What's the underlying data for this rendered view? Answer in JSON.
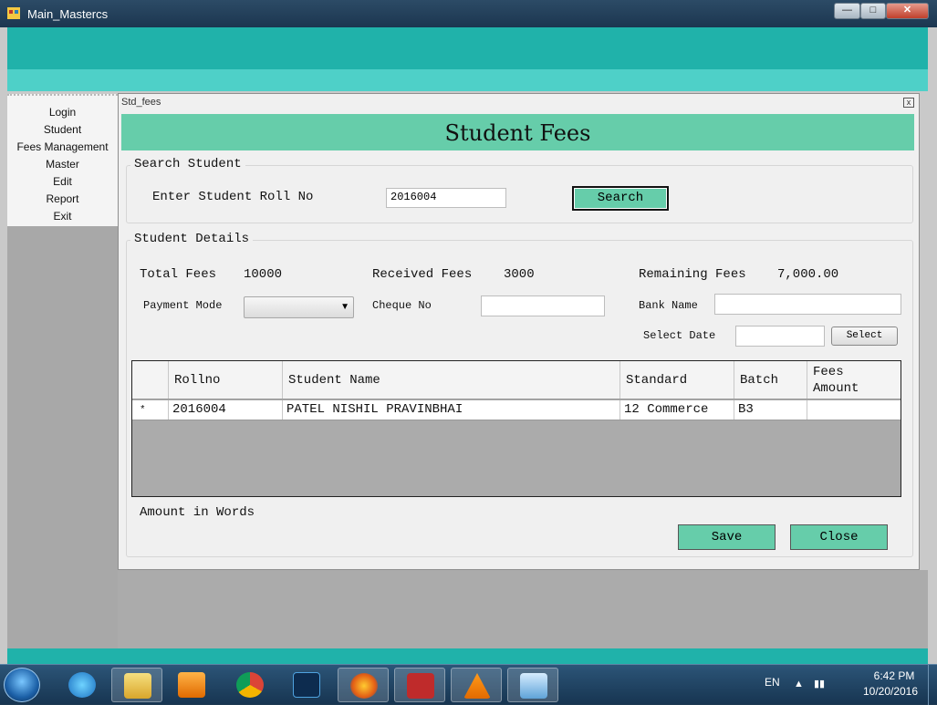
{
  "window": {
    "title": "Main_Mastercs",
    "min_label": "—",
    "max_label": "□",
    "close_label": "✕"
  },
  "menu": {
    "items": [
      "Login",
      "Student",
      "Fees Management",
      "Master",
      "Edit",
      "Report",
      "Exit"
    ]
  },
  "form": {
    "title": "Std_fees",
    "close_label": "x",
    "header": "Student Fees",
    "search": {
      "group_label": "Search Student",
      "roll_label": "Enter Student Roll No",
      "roll_value": "2016004",
      "button": "Search"
    },
    "details": {
      "group_label": "Student Details",
      "total_fees_label": "Total Fees",
      "total_fees_value": "10000",
      "received_fees_label": "Received Fees",
      "received_fees_value": "3000",
      "remaining_fees_label": "Remaining Fees",
      "remaining_fees_value": "7,000.00",
      "payment_mode_label": "Payment Mode",
      "payment_mode_value": "",
      "cheque_no_label": "Cheque No",
      "cheque_no_value": "",
      "bank_name_label": "Bank Name",
      "bank_name_value": "",
      "select_date_label": "Select Date",
      "select_date_value": "",
      "select_button": "Select"
    },
    "grid": {
      "columns": [
        "Rollno",
        "Student Name",
        "Standard",
        "Batch",
        "Fees Amount"
      ],
      "rows": [
        {
          "marker": "*",
          "rollno": "2016004",
          "name": "PATEL NISHIL PRAVINBHAI",
          "standard": "12 Commerce",
          "batch": "B3",
          "fees_amount": ""
        }
      ]
    },
    "amount_words_label": "Amount in Words",
    "save_button": "Save",
    "close_button": "Close"
  },
  "taskbar": {
    "apps": [
      "internet-explorer",
      "file-explorer",
      "media-player",
      "chrome",
      "photoshop",
      "firefox",
      "filezilla",
      "vlc",
      "student-app"
    ],
    "language": "EN",
    "time": "6:42 PM",
    "date": "10/20/2016"
  },
  "colors": {
    "teal": "#20b2aa",
    "banner": "#66cdaa",
    "label_red": "#e0141c"
  }
}
